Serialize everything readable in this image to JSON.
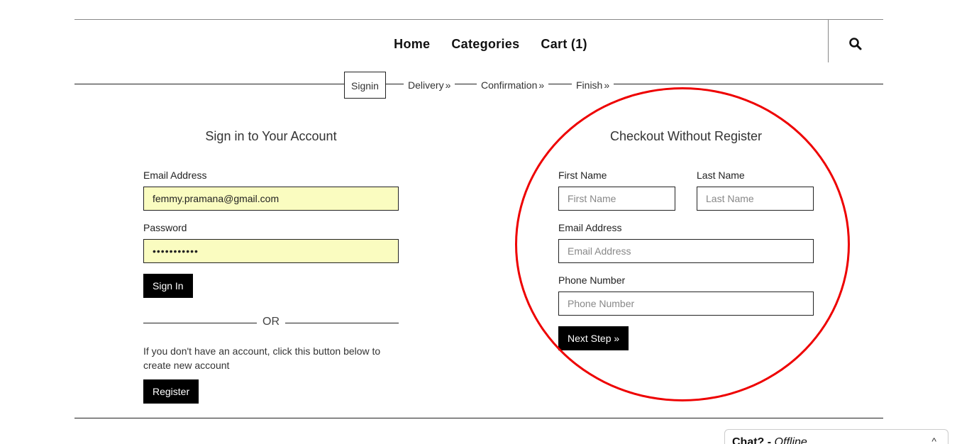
{
  "header": {
    "nav": [
      {
        "label": "Home"
      },
      {
        "label": "Categories"
      },
      {
        "label": "Cart (1)"
      }
    ],
    "search_icon": "search-icon"
  },
  "steps": [
    {
      "label": "Signin",
      "active": true
    },
    {
      "label": "Delivery",
      "chevron": "»"
    },
    {
      "label": "Confirmation",
      "chevron": "»"
    },
    {
      "label": "Finish",
      "chevron": "»"
    }
  ],
  "signin": {
    "title": "Sign in to Your Account",
    "email_label": "Email Address",
    "email_value": "femmy.pramana@gmail.com",
    "password_label": "Password",
    "password_value": "•••••••••••",
    "signin_button": "Sign In",
    "or_text": "OR",
    "register_note": "If you don't have an account, click this button below to create new account",
    "register_button": "Register"
  },
  "guest": {
    "title": "Checkout Without Register",
    "first_name_label": "First Name",
    "first_name_placeholder": "First Name",
    "last_name_label": "Last Name",
    "last_name_placeholder": "Last Name",
    "email_label": "Email Address",
    "email_placeholder": "Email Address",
    "phone_label": "Phone Number",
    "phone_placeholder": "Phone Number",
    "next_button": "Next Step »"
  },
  "chat": {
    "title": "Chat?",
    "separator": " - ",
    "status": "Offline",
    "caret": "^"
  },
  "colors": {
    "autofill": "#fafcc0",
    "highlight": "#ee0000",
    "button": "#000000"
  }
}
